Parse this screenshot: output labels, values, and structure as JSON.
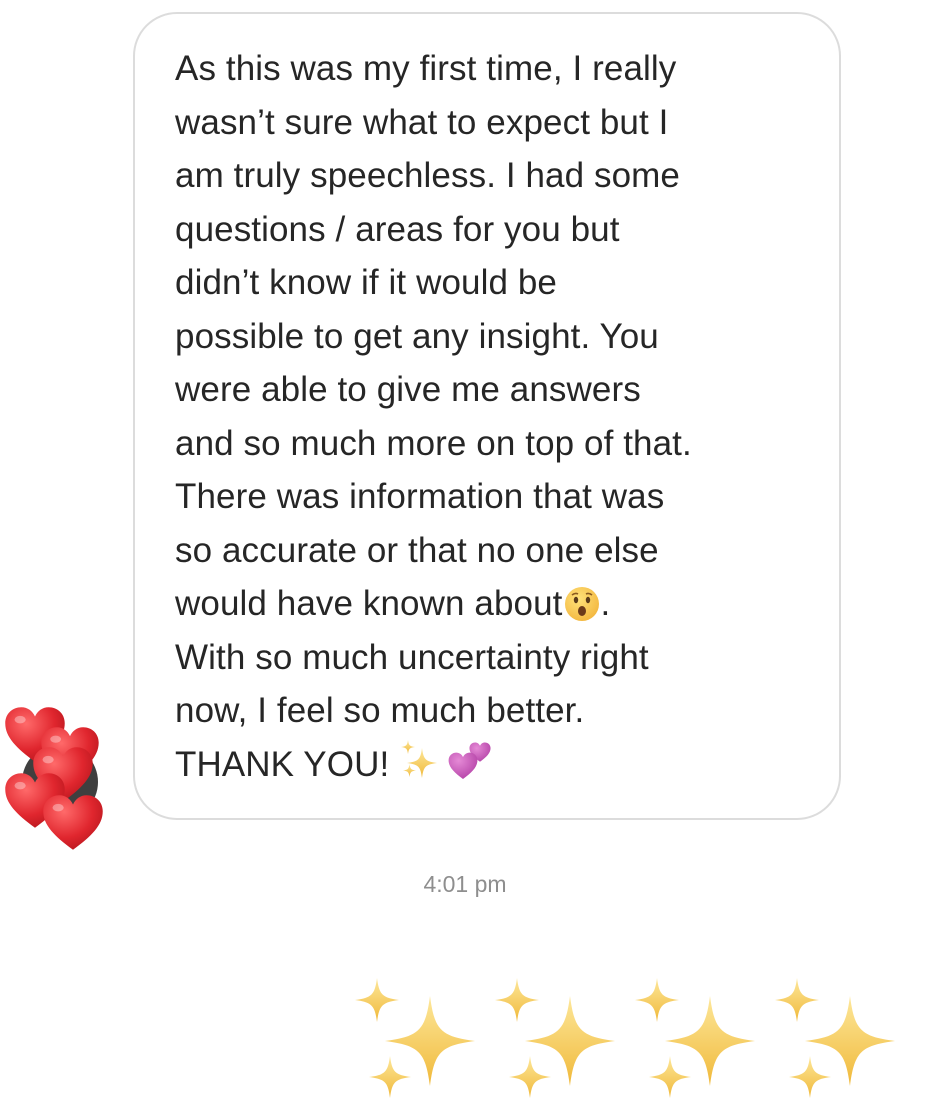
{
  "message": {
    "lines": [
      "As this was my first time, I really",
      "wasn’t sure what to expect but I",
      "am truly speechless. I had some",
      "questions / areas for you but",
      "didn’t know if it would be",
      "possible to get any insight. You",
      "were able to give me answers",
      "and so much more on top of that.",
      "There was information that was",
      "so accurate or that no one else",
      "would have known about",
      "With so much uncertainty right",
      "now, I feel so much better.",
      "THANK YOU! "
    ],
    "line_11_suffix": ".",
    "emojis": {
      "after_line_11": "hushed-face",
      "after_line_14": [
        "sparkles",
        "two-hearts"
      ]
    }
  },
  "reaction": {
    "emoji": "hearts",
    "color": "#e0262e"
  },
  "timestamp": "4:01 pm",
  "reply": {
    "emoji": "sparkles",
    "count": 4,
    "color": "#f5c84c"
  },
  "colors": {
    "text": "#262626",
    "bubble_border": "#dcdcdc",
    "timestamp": "#8e8e8e"
  }
}
